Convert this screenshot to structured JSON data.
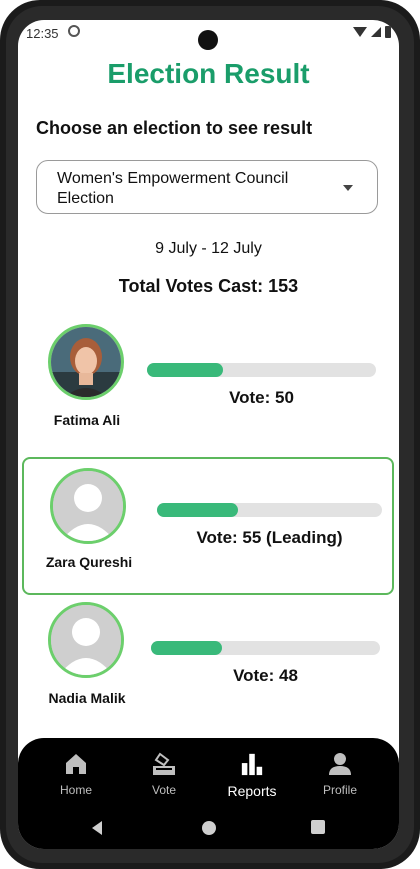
{
  "status": {
    "time": "12:35"
  },
  "header": {
    "title": "Election Result",
    "subtitle": "Choose an election to see result"
  },
  "election_select": {
    "value": "Women's Empowerment Council Election"
  },
  "election_info": {
    "dates": "9 July  - 12 July",
    "total_votes": "Total Votes Cast: 153"
  },
  "candidates": [
    {
      "name": "Fatima Ali",
      "vote_text": "Vote: 50",
      "vote_share": 0.33,
      "photo": "portrait"
    },
    {
      "name": "Zara Qureshi",
      "vote_text": "Vote: 55 (Leading)",
      "vote_share": 0.36,
      "photo": "placeholder"
    },
    {
      "name": "Nadia Malik",
      "vote_text": "Vote: 48",
      "vote_share": 0.31,
      "photo": "placeholder"
    }
  ],
  "nav": [
    {
      "label": "Home",
      "icon": "home-icon"
    },
    {
      "label": "Vote",
      "icon": "ballot-icon"
    },
    {
      "label": "Reports",
      "icon": "bar-chart-icon",
      "active": true
    },
    {
      "label": "Profile",
      "icon": "person-icon"
    }
  ],
  "colors": {
    "accent": "#1a9d6a",
    "bar": "#39b97a",
    "leading_border": "#5cb85c"
  }
}
